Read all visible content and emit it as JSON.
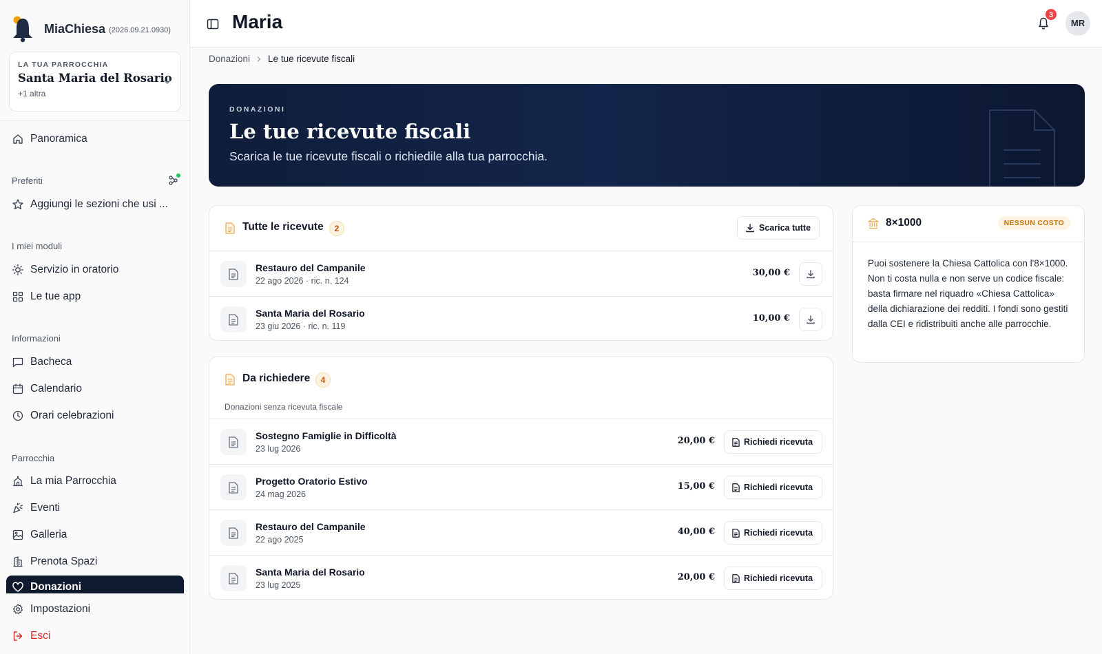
{
  "brand": {
    "name": "MiaChiesa",
    "version": "(2026.09.21.0930)"
  },
  "parish": {
    "eyebrow": "LA TUA PARROCCHIA",
    "name": "Santa Maria del Rosario",
    "more": "+1 altra"
  },
  "nav": {
    "overview": "Panoramica",
    "favorites_label": "Preferiti",
    "favorites_hint": "Aggiungi le sezioni che usi ...",
    "modules_label": "I miei moduli",
    "oratory": "Servizio in oratorio",
    "apps": "Le tue app",
    "info_label": "Informazioni",
    "board": "Bacheca",
    "calendar": "Calendario",
    "masses": "Orari celebrazioni",
    "parish_label": "Parrocchia",
    "my_parish": "La mia Parrocchia",
    "events": "Eventi",
    "gallery": "Galleria",
    "book_spaces": "Prenota Spazi",
    "donations": "Donazioni",
    "settings": "Impostazioni",
    "logout": "Esci"
  },
  "header": {
    "title": "Maria",
    "notifications": "3",
    "avatar": "MR"
  },
  "breadcrumb": {
    "parent": "Donazioni",
    "current": "Le tue ricevute fiscali"
  },
  "hero": {
    "eyebrow": "DONAZIONI",
    "title": "Le tue ricevute fiscali",
    "subtitle": "Scarica le tue ricevute fiscali o richiedile alla tua parrocchia."
  },
  "receipts": {
    "title": "Tutte le ricevute",
    "count": "2",
    "download_all": "Scarica tutte",
    "items": [
      {
        "name": "Restauro del Campanile",
        "meta": "22 ago 2026 · ric. n. 124",
        "amount": "30,00 €"
      },
      {
        "name": "Santa Maria del Rosario",
        "meta": "23 giu 2026 · ric. n. 119",
        "amount": "10,00 €"
      }
    ]
  },
  "to_request": {
    "title": "Da richiedere",
    "count": "4",
    "caption": "Donazioni senza ricevuta fiscale",
    "button": "Richiedi ricevuta",
    "items": [
      {
        "name": "Sostegno Famiglie in Difficoltà",
        "date": "23 lug 2026",
        "amount": "20,00 €"
      },
      {
        "name": "Progetto Oratorio Estivo",
        "date": "24 mag 2026",
        "amount": "15,00 €"
      },
      {
        "name": "Restauro del Campanile",
        "date": "22 ago 2025",
        "amount": "40,00 €"
      },
      {
        "name": "Santa Maria del Rosario",
        "date": "23 lug 2025",
        "amount": "20,00 €"
      }
    ]
  },
  "otto_per_mille": {
    "title": "8×1000",
    "tag": "NESSUN COSTO",
    "body": "Puoi sostenere la Chiesa Cattolica con l'8×1000. Non ti costa nulla e non serve un codice fiscale: basta firmare nel riquadro «Chiesa Cattolica» della dichiarazione dei redditi. I fondi sono gestiti dalla CEI e ridistribuiti anche alle parrocchie."
  },
  "colors": {
    "navy": "#0f1a2e",
    "accent_amber": "#b45309",
    "danger": "#dc2626",
    "online_dot": "#22c55e"
  }
}
